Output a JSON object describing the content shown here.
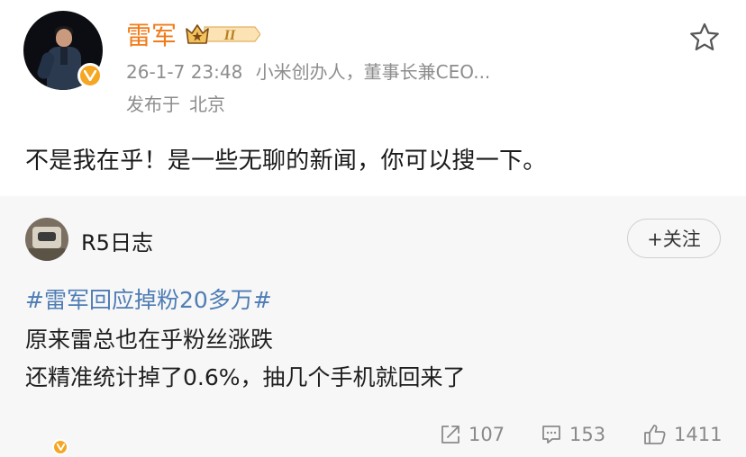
{
  "post": {
    "username": "雷军",
    "level_badge": "II",
    "timestamp": "26-1-7 23:48",
    "bio": "小米创办人，董事长兼CEO...",
    "location_label": "发布于",
    "location": "北京",
    "text": "不是我在乎！是一些无聊的新闻，你可以搜一下。"
  },
  "repost": {
    "username": "R5日志",
    "follow_label": "+关注",
    "hashtag": "#雷军回应掉粉20多万#",
    "line1": "原来雷总也在乎粉丝涨跌",
    "line2": "还精准统计掉了0.6%，抽几个手机就回来了",
    "repost_count": "107",
    "comment_count": "153",
    "like_count": "1411"
  },
  "icons": {
    "verified": "verified-v-icon",
    "crown": "crown-level-icon",
    "star": "star-outline-icon",
    "repost": "repost-icon",
    "comment": "comment-icon",
    "like": "thumbs-up-icon"
  },
  "colors": {
    "username": "#f07b19",
    "hashtag": "#4f7db5",
    "verified": "#f5a623",
    "muted": "#8d8d8d",
    "repost_bg": "#f7f7f7"
  }
}
